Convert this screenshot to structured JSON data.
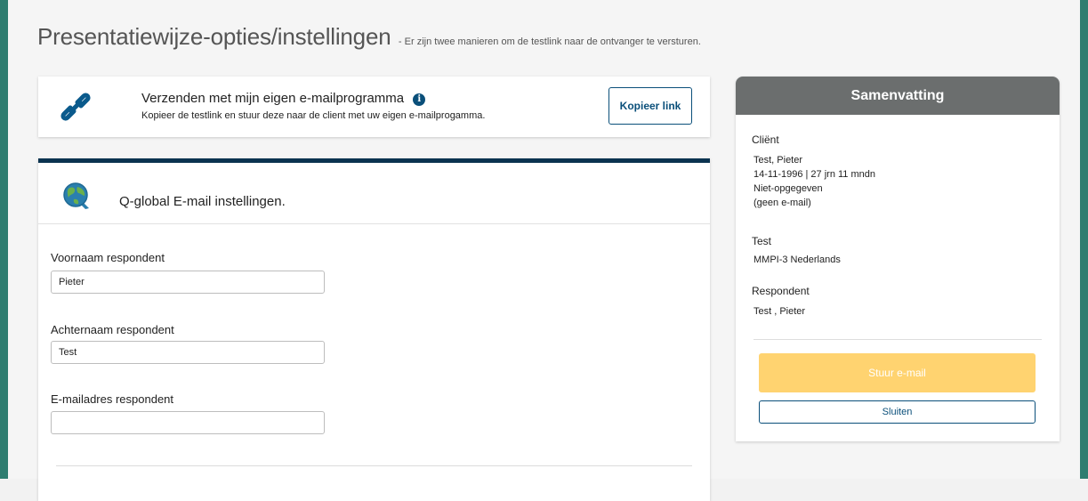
{
  "page": {
    "title": "Presentatiewijze-opties/instellingen",
    "subtitle": "- Er zijn twee manieren om de testlink naar de ontvanger te versturen."
  },
  "email_program": {
    "title": "Verzenden met mijn eigen e-mailprogramma",
    "description": "Kopieer de testlink en stuur deze naar de client met uw eigen e-mailprogamma.",
    "copy_button": "Kopieer link",
    "icon": "link-icon",
    "info_icon_glyph": "i"
  },
  "qglobal": {
    "title": "Q-global E-mail instellingen.",
    "icon": "q-global-logo",
    "fields": {
      "first_name": {
        "label": "Voornaam respondent",
        "value": "Pieter"
      },
      "last_name": {
        "label": "Achternaam respondent",
        "value": "Test"
      },
      "email": {
        "label": "E-mailadres respondent",
        "value": ""
      }
    }
  },
  "summary": {
    "header": "Samenvatting",
    "client": {
      "title": "Cliënt",
      "name": "Test, Pieter",
      "dob_age": "14-11-1996  |  27 jrn 11 mndn",
      "gender": "Niet-opgegeven",
      "email": "(geen e-mail)"
    },
    "test": {
      "title": "Test",
      "name": "MMPI-3 Nederlands"
    },
    "respondent": {
      "title": "Respondent",
      "name": "Test , Pieter"
    },
    "send_button": "Stuur e-mail",
    "close_button": "Sluiten"
  },
  "colors": {
    "accent_teal": "#2e7d70",
    "navy": "#0b3350",
    "button_blue": "#0a4f7a",
    "summary_header": "#6b6e6e",
    "send_button": "#ffd370"
  }
}
